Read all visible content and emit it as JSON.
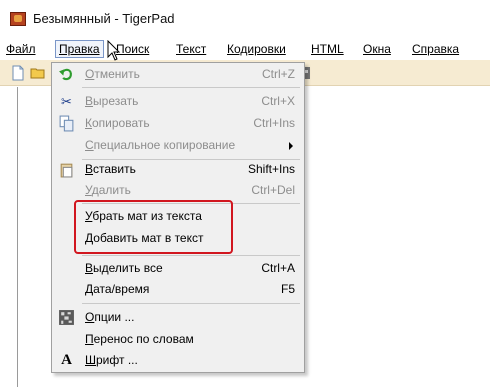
{
  "window": {
    "title": "Безымянный - TigerPad",
    "icon": "tigerpad-app-icon"
  },
  "menubar": [
    {
      "label": "Файл",
      "first": "Ф",
      "rest": "айл"
    },
    {
      "label": "Правка",
      "first": "П",
      "rest": "равка"
    },
    {
      "label": "Поиск",
      "first": "П",
      "rest": "оиск"
    },
    {
      "label": "Текст",
      "first": "Т",
      "rest": "екст"
    },
    {
      "label": "Кодировки",
      "first": "К",
      "rest": "одировки"
    },
    {
      "label": "HTML",
      "first": "H",
      "rest": "TML"
    },
    {
      "label": "Окна",
      "first": "О",
      "rest": "кна"
    },
    {
      "label": "Справка",
      "first": "С",
      "rest": "правка"
    }
  ],
  "edit_menu": {
    "items": [
      {
        "label_u": "О",
        "label_rest": "тменить",
        "shortcut": "Ctrl+Z",
        "enabled": false,
        "icon": "undo-icon"
      },
      {
        "label_u": "В",
        "label_rest": "ырезать",
        "shortcut": "Ctrl+X",
        "enabled": false,
        "icon": "scissors-icon"
      },
      {
        "label_u": "К",
        "label_rest": "опировать",
        "shortcut": "Ctrl+Ins",
        "enabled": false,
        "icon": "copy-icon"
      },
      {
        "label_u": "С",
        "label_rest": "пециальное копирование",
        "shortcut": "",
        "enabled": false,
        "icon": ""
      },
      {
        "label_u": "В",
        "label_rest": "ставить",
        "shortcut": "Shift+Ins",
        "enabled": true,
        "icon": "paste-icon"
      },
      {
        "label_u": "У",
        "label_rest": "далить",
        "shortcut": "Ctrl+Del",
        "enabled": false,
        "icon": ""
      },
      {
        "label_u": "У",
        "label_rest": "брать мат из текста",
        "shortcut": "",
        "enabled": true,
        "icon": ""
      },
      {
        "label_u": "Д",
        "label_rest": "обавить мат в текст",
        "shortcut": "",
        "enabled": true,
        "icon": ""
      },
      {
        "label_u": "В",
        "label_rest": "ыделить все",
        "shortcut": "Ctrl+A",
        "enabled": true,
        "icon": ""
      },
      {
        "label_u": "Д",
        "label_rest": "ата/время",
        "shortcut": "F5",
        "enabled": true,
        "icon": ""
      },
      {
        "label_u": "О",
        "label_rest": "пции ...",
        "shortcut": "",
        "enabled": true,
        "icon": "options-icon"
      },
      {
        "label_u": "П",
        "label_rest": "еренос по словам",
        "shortcut": "",
        "enabled": true,
        "icon": ""
      },
      {
        "label_u": "Ш",
        "label_rest": "рифт ...",
        "shortcut": "",
        "enabled": true,
        "icon": "font-icon"
      }
    ]
  },
  "colors": {
    "highlight_border": "#d1161f",
    "toolbar_bg": "#f6ebd2",
    "menu_bg": "#f0f0f0",
    "disabled_text": "#8d8d8d"
  }
}
